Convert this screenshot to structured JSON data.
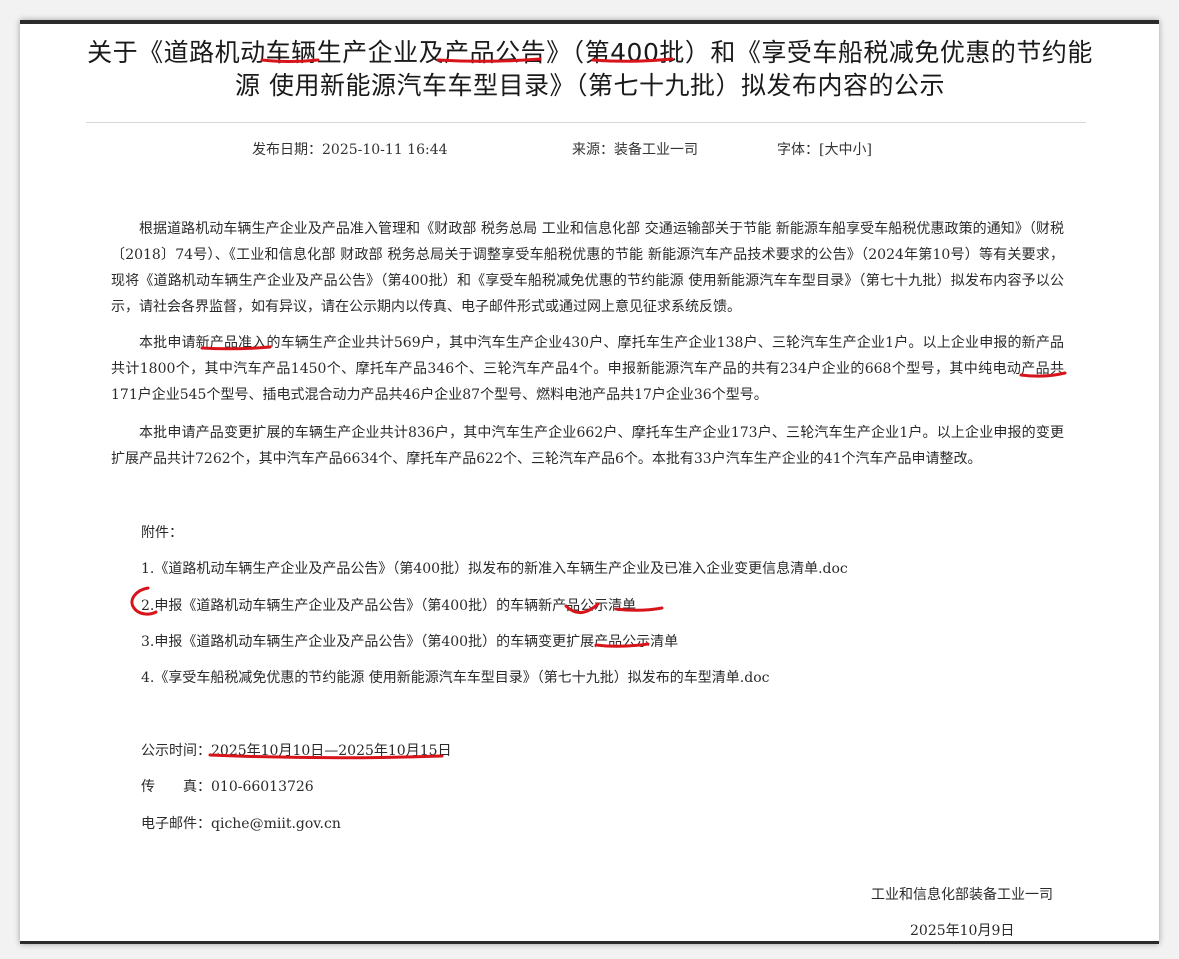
{
  "notice": {
    "title": "关于《道路机动车辆生产企业及产品公告》（第400批）和《享受车船税减免优惠的节约能源 使用新能源汽车车型目录》（第七十九批）拟发布内容的公示",
    "publish_date_label": "发布日期：",
    "publish_date": "2025-10-11 16:44",
    "source_label": "来源：",
    "source": "装备工业一司",
    "font_label": "字体：",
    "font_size_option": "[大中小]"
  },
  "body": {
    "paragraphs": [
      "根据道路机动车辆生产企业及产品准入管理和《财政部 税务总局 工业和信息化部 交通运输部关于节能 新能源车船享受车船税优惠政策的通知》（财税〔2018〕74号）、《工业和信息化部 财政部 税务总局关于调整享受车船税优惠的节能 新能源汽车产品技术要求的公告》（2024年第10号）等有关要求，现将《道路机动车辆生产企业及产品公告》（第400批）和《享受车船税减免优惠的节约能源 使用新能源汽车车型目录》（第七十九批）拟发布内容予以公示，请社会各界监督，如有异议，请在公示期内以传真、电子邮件形式或通过网上意见征求系统反馈。",
      "本批申请新产品准入的车辆生产企业共计569户，其中汽车生产企业430户、摩托车生产企业138户、三轮汽车生产企业1户。以上企业申报的新产品共计1800个，其中汽车产品1450个、摩托车产品346个、三轮汽车产品4个。申报新能源汽车产品的共有234户企业的668个型号，其中纯电动产品共171户企业545个型号、插电式混合动力产品共46户企业87个型号、燃料电池产品共17户企业36个型号。",
      "本批申请产品变更扩展的车辆生产企业共计836户，其中汽车生产企业662户、摩托车生产企业173户、三轮汽车生产企业1户。以上企业申报的变更扩展产品共计7262个，其中汽车产品6634个、摩托车产品622个、三轮汽车产品6个。本批有33户汽车生产企业的41个汽车产品申请整改。"
    ]
  },
  "attachments": {
    "heading": "附件：",
    "items": [
      "1.《道路机动车辆生产企业及产品公告》（第400批）拟发布的新准入车辆生产企业及已准入企业变更信息清单.doc",
      "2.申报《道路机动车辆生产企业及产品公告》（第400批）的车辆新产品公示清单",
      "3.申报《道路机动车辆生产企业及产品公告》（第400批）的车辆变更扩展产品公示清单",
      "4.《享受车船税减免优惠的节约能源 使用新能源汽车车型目录》（第七十九批）拟发布的车型清单.doc"
    ]
  },
  "contact": {
    "period_label": "公示时间：",
    "period": "2025年10月10日—2025年10月15日",
    "fax_label": "传　　真：",
    "fax": "010-66013726",
    "email_label": "电子邮件：",
    "email": "qiche@miit.gov.cn"
  },
  "signature": {
    "org": "工业和信息化部装备工业一司",
    "date": "2025年10月9日"
  },
  "annotation_color": "#d8141b"
}
